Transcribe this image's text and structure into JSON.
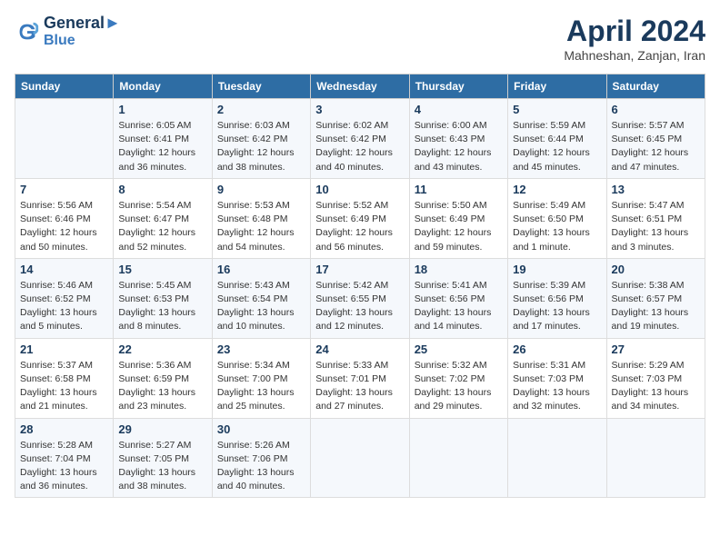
{
  "header": {
    "logo_line1": "General",
    "logo_line2": "Blue",
    "month_title": "April 2024",
    "location": "Mahneshan, Zanjan, Iran"
  },
  "days_of_week": [
    "Sunday",
    "Monday",
    "Tuesday",
    "Wednesday",
    "Thursday",
    "Friday",
    "Saturday"
  ],
  "weeks": [
    [
      {
        "num": "",
        "info": ""
      },
      {
        "num": "1",
        "info": "Sunrise: 6:05 AM\nSunset: 6:41 PM\nDaylight: 12 hours\nand 36 minutes."
      },
      {
        "num": "2",
        "info": "Sunrise: 6:03 AM\nSunset: 6:42 PM\nDaylight: 12 hours\nand 38 minutes."
      },
      {
        "num": "3",
        "info": "Sunrise: 6:02 AM\nSunset: 6:42 PM\nDaylight: 12 hours\nand 40 minutes."
      },
      {
        "num": "4",
        "info": "Sunrise: 6:00 AM\nSunset: 6:43 PM\nDaylight: 12 hours\nand 43 minutes."
      },
      {
        "num": "5",
        "info": "Sunrise: 5:59 AM\nSunset: 6:44 PM\nDaylight: 12 hours\nand 45 minutes."
      },
      {
        "num": "6",
        "info": "Sunrise: 5:57 AM\nSunset: 6:45 PM\nDaylight: 12 hours\nand 47 minutes."
      }
    ],
    [
      {
        "num": "7",
        "info": "Sunrise: 5:56 AM\nSunset: 6:46 PM\nDaylight: 12 hours\nand 50 minutes."
      },
      {
        "num": "8",
        "info": "Sunrise: 5:54 AM\nSunset: 6:47 PM\nDaylight: 12 hours\nand 52 minutes."
      },
      {
        "num": "9",
        "info": "Sunrise: 5:53 AM\nSunset: 6:48 PM\nDaylight: 12 hours\nand 54 minutes."
      },
      {
        "num": "10",
        "info": "Sunrise: 5:52 AM\nSunset: 6:49 PM\nDaylight: 12 hours\nand 56 minutes."
      },
      {
        "num": "11",
        "info": "Sunrise: 5:50 AM\nSunset: 6:49 PM\nDaylight: 12 hours\nand 59 minutes."
      },
      {
        "num": "12",
        "info": "Sunrise: 5:49 AM\nSunset: 6:50 PM\nDaylight: 13 hours\nand 1 minute."
      },
      {
        "num": "13",
        "info": "Sunrise: 5:47 AM\nSunset: 6:51 PM\nDaylight: 13 hours\nand 3 minutes."
      }
    ],
    [
      {
        "num": "14",
        "info": "Sunrise: 5:46 AM\nSunset: 6:52 PM\nDaylight: 13 hours\nand 5 minutes."
      },
      {
        "num": "15",
        "info": "Sunrise: 5:45 AM\nSunset: 6:53 PM\nDaylight: 13 hours\nand 8 minutes."
      },
      {
        "num": "16",
        "info": "Sunrise: 5:43 AM\nSunset: 6:54 PM\nDaylight: 13 hours\nand 10 minutes."
      },
      {
        "num": "17",
        "info": "Sunrise: 5:42 AM\nSunset: 6:55 PM\nDaylight: 13 hours\nand 12 minutes."
      },
      {
        "num": "18",
        "info": "Sunrise: 5:41 AM\nSunset: 6:56 PM\nDaylight: 13 hours\nand 14 minutes."
      },
      {
        "num": "19",
        "info": "Sunrise: 5:39 AM\nSunset: 6:56 PM\nDaylight: 13 hours\nand 17 minutes."
      },
      {
        "num": "20",
        "info": "Sunrise: 5:38 AM\nSunset: 6:57 PM\nDaylight: 13 hours\nand 19 minutes."
      }
    ],
    [
      {
        "num": "21",
        "info": "Sunrise: 5:37 AM\nSunset: 6:58 PM\nDaylight: 13 hours\nand 21 minutes."
      },
      {
        "num": "22",
        "info": "Sunrise: 5:36 AM\nSunset: 6:59 PM\nDaylight: 13 hours\nand 23 minutes."
      },
      {
        "num": "23",
        "info": "Sunrise: 5:34 AM\nSunset: 7:00 PM\nDaylight: 13 hours\nand 25 minutes."
      },
      {
        "num": "24",
        "info": "Sunrise: 5:33 AM\nSunset: 7:01 PM\nDaylight: 13 hours\nand 27 minutes."
      },
      {
        "num": "25",
        "info": "Sunrise: 5:32 AM\nSunset: 7:02 PM\nDaylight: 13 hours\nand 29 minutes."
      },
      {
        "num": "26",
        "info": "Sunrise: 5:31 AM\nSunset: 7:03 PM\nDaylight: 13 hours\nand 32 minutes."
      },
      {
        "num": "27",
        "info": "Sunrise: 5:29 AM\nSunset: 7:03 PM\nDaylight: 13 hours\nand 34 minutes."
      }
    ],
    [
      {
        "num": "28",
        "info": "Sunrise: 5:28 AM\nSunset: 7:04 PM\nDaylight: 13 hours\nand 36 minutes."
      },
      {
        "num": "29",
        "info": "Sunrise: 5:27 AM\nSunset: 7:05 PM\nDaylight: 13 hours\nand 38 minutes."
      },
      {
        "num": "30",
        "info": "Sunrise: 5:26 AM\nSunset: 7:06 PM\nDaylight: 13 hours\nand 40 minutes."
      },
      {
        "num": "",
        "info": ""
      },
      {
        "num": "",
        "info": ""
      },
      {
        "num": "",
        "info": ""
      },
      {
        "num": "",
        "info": ""
      }
    ]
  ]
}
